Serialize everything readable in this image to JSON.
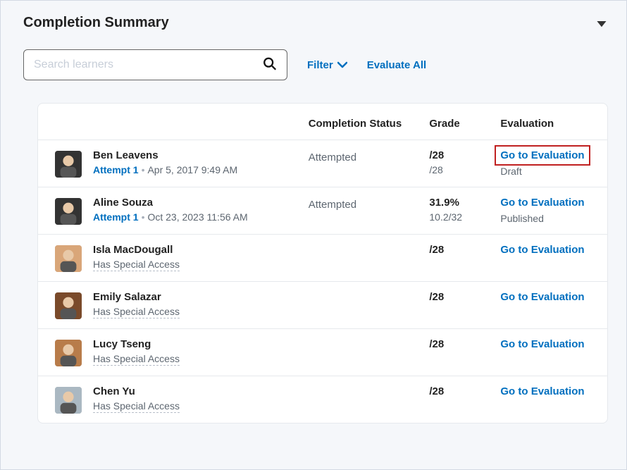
{
  "header": {
    "title": "Completion Summary"
  },
  "toolbar": {
    "search_placeholder": "Search learners",
    "filter_label": "Filter",
    "evaluate_all_label": "Evaluate All"
  },
  "table": {
    "columns": {
      "status": "Completion Status",
      "grade": "Grade",
      "evaluation": "Evaluation"
    },
    "rows": [
      {
        "name": "Ben Leavens",
        "attempt_label": "Attempt 1",
        "attempt_date": "Apr 5, 2017 9:49 AM",
        "special_access": "",
        "status": "Attempted",
        "grade_main": "/28",
        "grade_sub": "/28",
        "eval_link": "Go to Evaluation",
        "eval_status": "Draft",
        "eval_highlight": true
      },
      {
        "name": "Aline Souza",
        "attempt_label": "Attempt 1",
        "attempt_date": "Oct 23, 2023 11:56 AM",
        "special_access": "",
        "status": "Attempted",
        "grade_main": "31.9%",
        "grade_sub": "10.2/32",
        "eval_link": "Go to Evaluation",
        "eval_status": "Published",
        "eval_highlight": false
      },
      {
        "name": "Isla MacDougall",
        "attempt_label": "",
        "attempt_date": "",
        "special_access": "Has Special Access",
        "status": "",
        "grade_main": "/28",
        "grade_sub": "",
        "eval_link": "Go to Evaluation",
        "eval_status": "",
        "eval_highlight": false
      },
      {
        "name": "Emily Salazar",
        "attempt_label": "",
        "attempt_date": "",
        "special_access": "Has Special Access",
        "status": "",
        "grade_main": "/28",
        "grade_sub": "",
        "eval_link": "Go to Evaluation",
        "eval_status": "",
        "eval_highlight": false
      },
      {
        "name": "Lucy Tseng",
        "attempt_label": "",
        "attempt_date": "",
        "special_access": "Has Special Access",
        "status": "",
        "grade_main": "/28",
        "grade_sub": "",
        "eval_link": "Go to Evaluation",
        "eval_status": "",
        "eval_highlight": false
      },
      {
        "name": "Chen Yu",
        "attempt_label": "",
        "attempt_date": "",
        "special_access": "Has Special Access",
        "status": "",
        "grade_main": "/28",
        "grade_sub": "",
        "eval_link": "Go to Evaluation",
        "eval_status": "",
        "eval_highlight": false
      }
    ]
  }
}
